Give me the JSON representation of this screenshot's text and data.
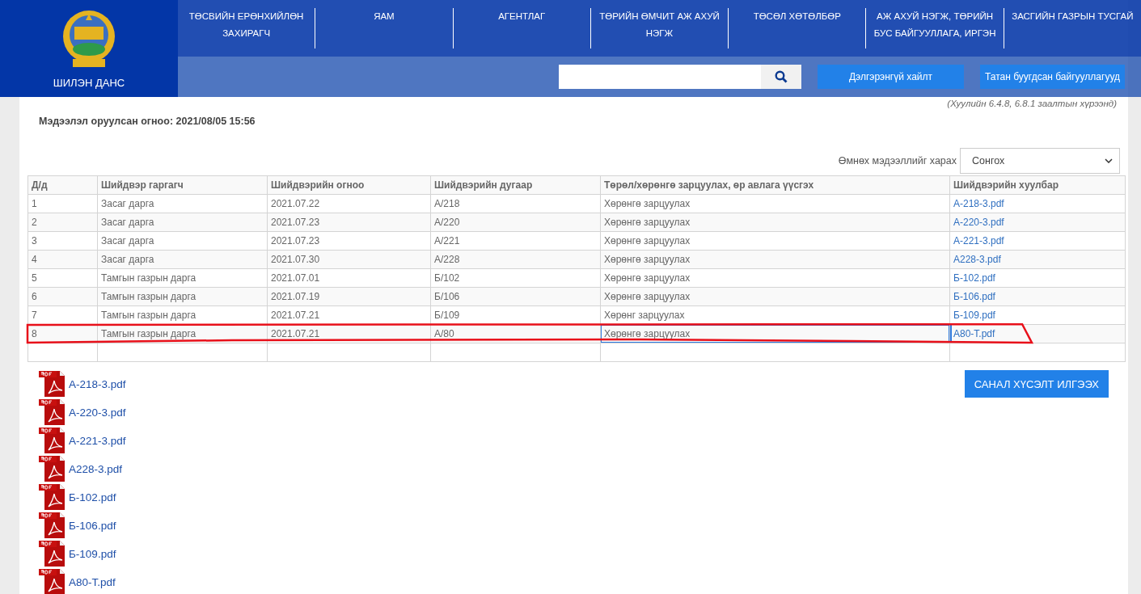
{
  "header": {
    "logo_text": "ШИЛЭН ДАНС",
    "nav": [
      {
        "label": "ТӨСВИЙН ЕРӨНХИЙЛӨН ЗАХИРАГЧ"
      },
      {
        "label": "ЯАМ"
      },
      {
        "label": "АГЕНТЛАГ"
      },
      {
        "label": "ТӨРИЙН ӨМЧИТ АЖ АХУЙ НЭГЖ"
      },
      {
        "label": "ТӨСӨЛ ХӨТӨЛБӨР"
      },
      {
        "label": "АЖ АХУЙ НЭГЖ, ТӨРИЙН БУС БАЙГУУЛЛАГА, ИРГЭН"
      },
      {
        "label": "ЗАСГИЙН ГАЗРЫН ТУСГАЙ"
      }
    ],
    "buttons": [
      "Дэлгэрэнгүй хайлт",
      "Татан буугдсан байгууллагууд"
    ]
  },
  "page": {
    "law_note": "(Хуулийн 6.4.8, 6.8.1 заалтын хүрээнд)",
    "updated": "Мэдээлэл оруулсан огноо: 2021/08/05 15:56",
    "history_label": "Өмнөх мэдээллийг харах",
    "history_select": "Сонгох"
  },
  "table": {
    "columns": [
      "Д/д",
      "Шийдвэр гаргагч",
      "Шийдвэрийн огноо",
      "Шийдвэрийн дугаар",
      "Төрөл/хөрөнгө зарцуулах, өр авлага үүсгэх",
      "Шийдвэрийн хуулбар"
    ],
    "rows": [
      {
        "cells": [
          "1",
          "Засаг дарга",
          "2021.07.22",
          "А/218",
          "Хөрөнгө зарцуулах"
        ],
        "file": "А-218-3.pdf",
        "selected": false,
        "marked": false
      },
      {
        "cells": [
          "2",
          "Засаг дарга",
          "2021.07.23",
          "А/220",
          "Хөрөнгө зарцуулах"
        ],
        "file": "А-220-3.pdf",
        "selected": false,
        "marked": false
      },
      {
        "cells": [
          "3",
          "Засаг дарга",
          "2021.07.23",
          "А/221",
          "Хөрөнгө зарцуулах"
        ],
        "file": "А-221-3.pdf",
        "selected": false,
        "marked": false
      },
      {
        "cells": [
          "4",
          "Засаг дарга",
          "2021.07.30",
          "А/228",
          "Хөрөнгө зарцуулах"
        ],
        "file": "А228-3.pdf",
        "selected": false,
        "marked": false
      },
      {
        "cells": [
          "5",
          "Тамгын газрын дарга",
          "2021.07.01",
          "Б/102",
          "Хөрөнгө зарцуулах"
        ],
        "file": "Б-102.pdf",
        "selected": false,
        "marked": false
      },
      {
        "cells": [
          "6",
          "Тамгын газрын дарга",
          "2021.07.19",
          "Б/106",
          "Хөрөнгө зарцуулах"
        ],
        "file": "Б-106.pdf",
        "selected": false,
        "marked": false
      },
      {
        "cells": [
          "7",
          "Тамгын газрын дарга",
          "2021.07.21",
          "Б/109",
          "Хөрөнг зарцуулах"
        ],
        "file": "Б-109.pdf",
        "selected": false,
        "marked": false
      },
      {
        "cells": [
          "8",
          "Тамгын газрын дарга",
          "2021.07.21",
          "А/80",
          "Хөрөнгө зарцуулах"
        ],
        "file": "А80-Т.pdf",
        "selected": true,
        "marked": true
      }
    ]
  },
  "attachments": [
    "А-218-3.pdf",
    "А-220-3.pdf",
    "А-221-3.pdf",
    "А228-3.pdf",
    "Б-102.pdf",
    "Б-106.pdf",
    "Б-109.pdf",
    "А80-Т.pdf"
  ],
  "feedback_button": "САНАЛ ХҮСЭЛТ ИЛГЭЭХ"
}
